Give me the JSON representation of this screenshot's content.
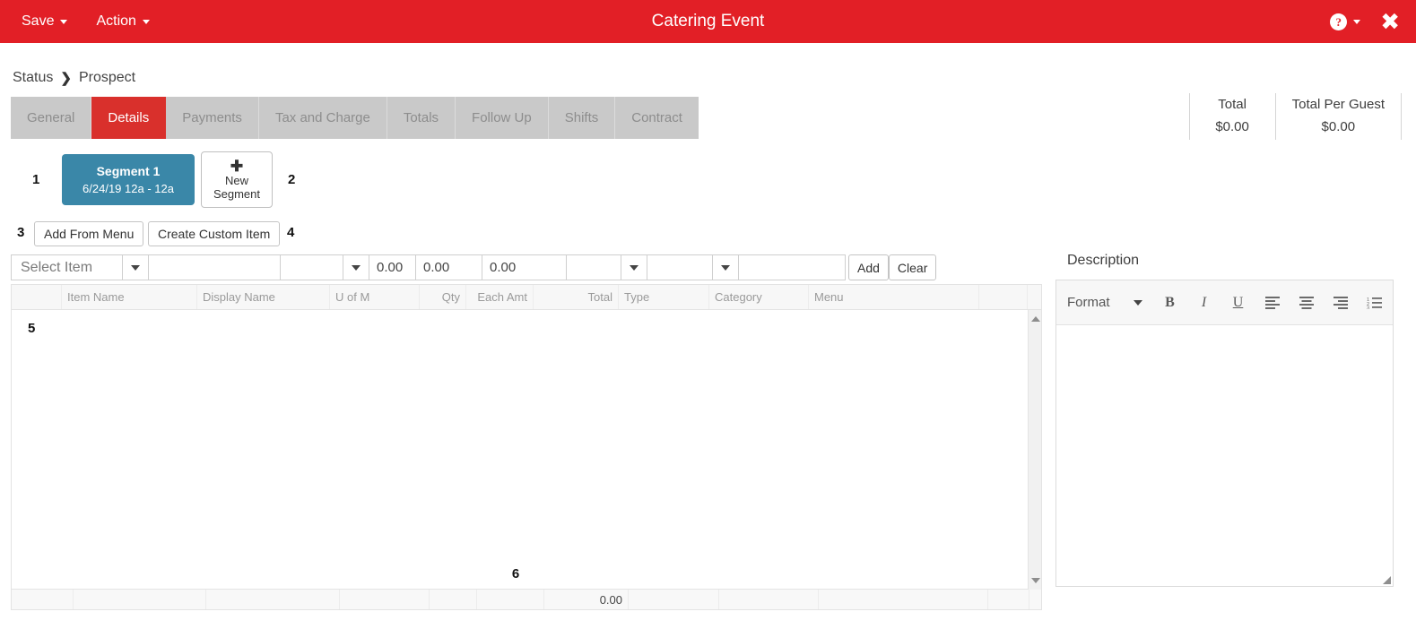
{
  "appbar": {
    "title": "Catering Event",
    "menus": [
      {
        "label": "Save",
        "icon": "caret-down-icon"
      },
      {
        "label": "Action",
        "icon": "caret-down-icon"
      }
    ],
    "help_glyph": "?",
    "close_glyph": "✖",
    "background_color": "#e21f26"
  },
  "breadcrumb": {
    "root": "Status",
    "separator": "❯",
    "current": "Prospect"
  },
  "tabs": [
    {
      "label": "General",
      "active": false
    },
    {
      "label": "Details",
      "active": true
    },
    {
      "label": "Payments",
      "active": false
    },
    {
      "label": "Tax and Charge",
      "active": false
    },
    {
      "label": "Totals",
      "active": false
    },
    {
      "label": "Follow Up",
      "active": false
    },
    {
      "label": "Shifts",
      "active": false
    },
    {
      "label": "Contract",
      "active": false
    }
  ],
  "tab_active_color": "#d9302c",
  "totals": [
    {
      "label": "Total",
      "value": "$0.00"
    },
    {
      "label": "Total Per Guest",
      "value": "$0.00"
    }
  ],
  "steps": {
    "one": "1",
    "two": "2",
    "three": "3",
    "four": "4",
    "five": "5",
    "six": "6"
  },
  "segment": {
    "title": "Segment 1",
    "subtitle": "6/24/19 12a - 12a",
    "color": "#3a87a8",
    "new_segment_plus": "✚",
    "new_segment_line1": "New",
    "new_segment_line2": "Segment"
  },
  "actions": {
    "add_from_menu": "Add From Menu",
    "create_custom_item": "Create Custom Item"
  },
  "entry_row": {
    "select_item_placeholder": "Select Item",
    "display_name_value": "",
    "uofm_value": "",
    "qty_value": "0.00",
    "each_amt_value": "0.00",
    "total_value": "0.00",
    "type_value": "",
    "category_value": "",
    "menu_value": "",
    "add_label": "Add",
    "clear_label": "Clear"
  },
  "grid": {
    "columns": [
      "",
      "Item Name",
      "Display Name",
      "U of M",
      "Qty",
      "Each Amt",
      "Total",
      "Type",
      "Category",
      "Menu",
      "",
      ""
    ],
    "rows": [],
    "footer": [
      "",
      "",
      "",
      "",
      "",
      "",
      "0.00",
      "",
      "",
      "",
      "",
      ""
    ],
    "footer_total": "0.00"
  },
  "description": {
    "label": "Description",
    "format_label": "Format",
    "toolbar": [
      {
        "name": "bold-icon",
        "glyph": "B"
      },
      {
        "name": "italic-icon",
        "glyph": "I"
      },
      {
        "name": "underline-icon",
        "glyph": "U"
      },
      {
        "name": "align-left-icon",
        "glyph": ""
      },
      {
        "name": "align-center-icon",
        "glyph": ""
      },
      {
        "name": "align-right-icon",
        "glyph": ""
      },
      {
        "name": "numbered-list-icon",
        "glyph": ""
      }
    ],
    "body_value": ""
  }
}
